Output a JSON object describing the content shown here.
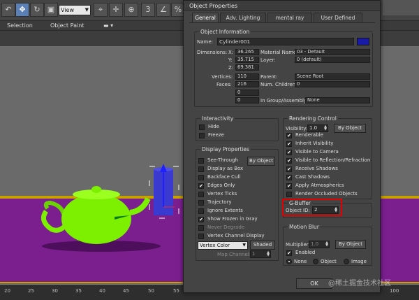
{
  "toolbar": {
    "view_select": "View",
    "labels": [
      "Selection",
      "Object Paint"
    ]
  },
  "timeline": {
    "ticks": [
      "20",
      "25",
      "30",
      "35",
      "40",
      "45",
      "50",
      "55",
      "100"
    ]
  },
  "dialog": {
    "title": "Object Properties",
    "tabs": [
      "General",
      "Adv. Lighting",
      "mental ray",
      "User Defined"
    ],
    "object_information": {
      "title": "Object Information",
      "name_label": "Name:",
      "name_value": "Cylinder001",
      "name_color": "#1a1aa8",
      "dimensions_label": "Dimensions:",
      "x_label": "X:",
      "x_value": "36.265",
      "y_label": "Y:",
      "y_value": "35.715",
      "z_label": "Z:",
      "z_value": "69.381",
      "material_label": "Material Name:",
      "material_value": "03 - Default",
      "layer_label": "Layer:",
      "layer_value": "0 (default)",
      "vertices_label": "Vertices:",
      "vertices_value": "110",
      "faces_label": "Faces:",
      "faces_value": "216",
      "parent_label": "Parent:",
      "parent_value": "Scene Root",
      "children_label": "Num. Children:",
      "children_value": "0",
      "extra_1": "0",
      "extra_2": "0",
      "group_label": "In Group/Assembly:",
      "group_value": "None"
    },
    "interactivity": {
      "title": "Interactivity",
      "hide": "Hide",
      "freeze": "Freeze"
    },
    "display_properties": {
      "title": "Display Properties",
      "by_object": "By Object",
      "items": [
        {
          "label": "See-Through",
          "checked": false
        },
        {
          "label": "Display as Box",
          "checked": false
        },
        {
          "label": "Backface Cull",
          "checked": false
        },
        {
          "label": "Edges Only",
          "checked": true
        },
        {
          "label": "Vertex Ticks",
          "checked": false
        },
        {
          "label": "Trajectory",
          "checked": false
        },
        {
          "label": "Ignore Extents",
          "checked": false
        },
        {
          "label": "Show Frozen in Gray",
          "checked": true
        },
        {
          "label": "Never Degrade",
          "checked": false
        },
        {
          "label": "Vertex Channel Display",
          "checked": false
        }
      ],
      "vertex_color": "Vertex Color",
      "shaded": "Shaded",
      "map_channel_label": "Map Channel:",
      "map_channel_value": "1"
    },
    "rendering_control": {
      "title": "Rendering Control",
      "visibility_label": "Visibility:",
      "visibility_value": "1.0",
      "by_object": "By Object",
      "items": [
        {
          "label": "Renderable",
          "checked": true
        },
        {
          "label": "Inherit Visibility",
          "checked": true
        },
        {
          "label": "Visible to Camera",
          "checked": true
        },
        {
          "label": "Visible to Reflection/Refraction",
          "checked": true
        },
        {
          "label": "Receive Shadows",
          "checked": true
        },
        {
          "label": "Cast Shadows",
          "checked": true
        },
        {
          "label": "Apply Atmospherics",
          "checked": true
        },
        {
          "label": "Render Occluded Objects",
          "checked": false
        }
      ]
    },
    "gbuffer": {
      "title": "G-Buffer",
      "object_id_label": "Object ID:",
      "object_id_value": "2"
    },
    "motion_blur": {
      "title": "Motion Blur",
      "multiplier_label": "Multiplier:",
      "multiplier_value": "1.0",
      "by_object": "By Object",
      "enabled_label": "Enabled",
      "radios": [
        "None",
        "Object",
        "Image"
      ]
    },
    "ok": "OK"
  },
  "watermark": "@稀土掘金技术社区",
  "colors": {
    "highlight": "#e00000",
    "teapot": "#7cf000",
    "cylinder": "#3a3ad0",
    "floor": "#7b1f8f"
  }
}
